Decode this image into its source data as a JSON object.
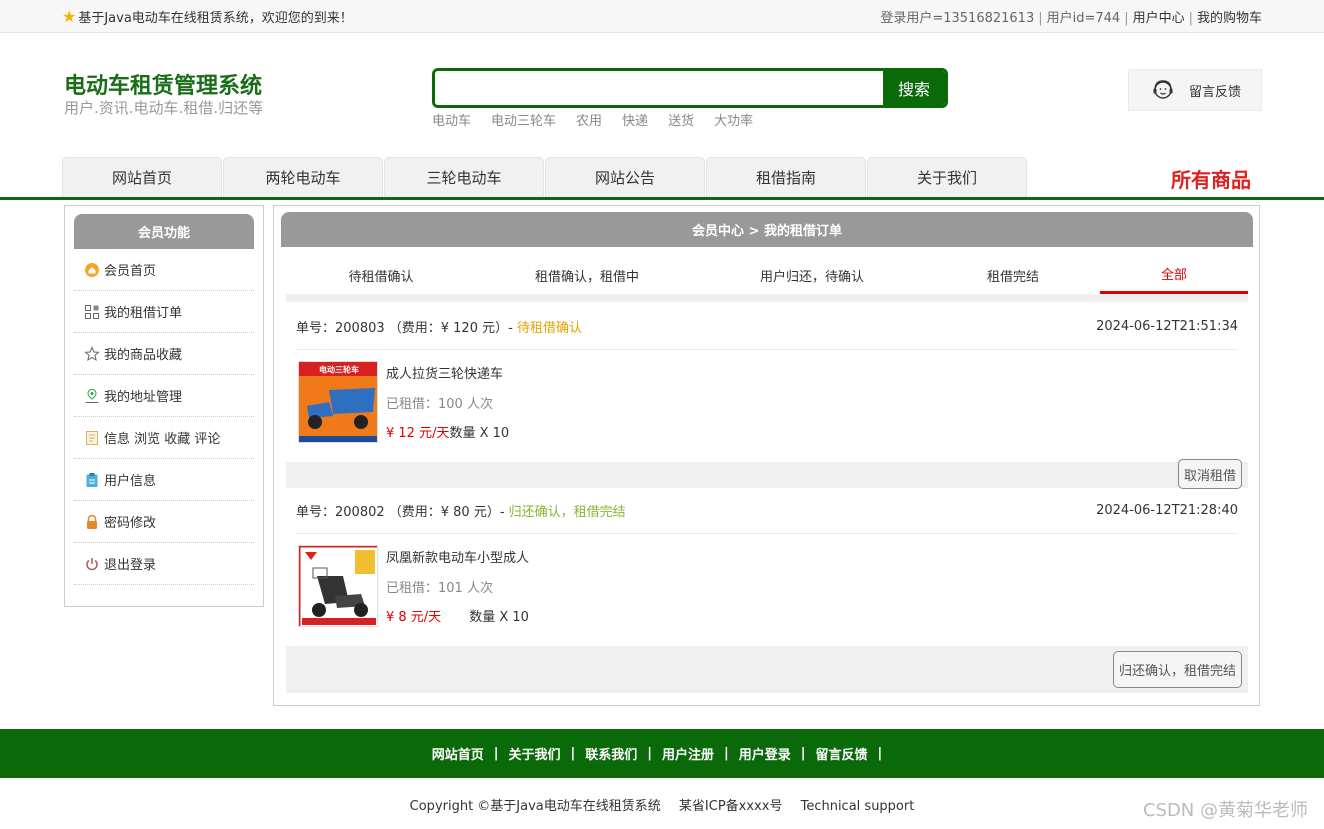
{
  "topbar": {
    "welcome": "基于Java电动车在线租赁系统，欢迎您的到来！",
    "login_user": "登录用户=13516821613",
    "user_id": "用户id=744",
    "user_center": "用户中心",
    "my_cart": "我的购物车"
  },
  "header": {
    "title": "电动车租赁管理系统",
    "subtitle": "用户.资讯.电动车.租借.归还等",
    "search_value": "",
    "search_button": "搜索",
    "hot_words": [
      "电动车",
      "电动三轮车",
      "农用",
      "快递",
      "送货",
      "大功率"
    ],
    "feedback": "留言反馈"
  },
  "nav": {
    "tabs": [
      "网站首页",
      "两轮电动车",
      "三轮电动车",
      "网站公告",
      "租借指南",
      "关于我们"
    ],
    "all_goods": "所有商品"
  },
  "sidebar": {
    "title": "会员功能",
    "items": [
      {
        "label": "会员首页",
        "icon": "home-icon"
      },
      {
        "label": "我的租借订单",
        "icon": "orders-icon"
      },
      {
        "label": "我的商品收藏",
        "icon": "star-icon"
      },
      {
        "label": "我的地址管理",
        "icon": "location-icon"
      },
      {
        "label": "信息 浏览 收藏 评论",
        "icon": "document-icon"
      },
      {
        "label": "用户信息",
        "icon": "clipboard-icon"
      },
      {
        "label": "密码修改",
        "icon": "lock-icon"
      },
      {
        "label": "退出登录",
        "icon": "power-icon"
      }
    ]
  },
  "main": {
    "breadcrumb": "会员中心 > 我的租借订单",
    "status_tabs": [
      "待租借确认",
      "租借确认，租借中",
      "用户归还，待确认",
      "租借完结",
      "全部"
    ],
    "active_tab": "全部",
    "orders": [
      {
        "order_no_label": "单号：200803 （费用：¥ 120 元）-",
        "status": "待租借确认",
        "time": "2024-06-12T21:51:34",
        "product_name": "成人拉货三轮快递车",
        "rented": "已租借：100 人次",
        "price": "¥ 12 元/天",
        "qty": "数量 X 10",
        "action": "取消租借"
      },
      {
        "order_no_label": "单号：200802 （费用：¥ 80 元）-",
        "status": "归还确认，租借完结",
        "time": "2024-06-12T21:28:40",
        "product_name": "凤凰新款电动车小型成人",
        "rented": "已租借：101 人次",
        "price": "¥ 8 元/天",
        "qty": "数量 X 10",
        "action": "归还确认，租借完结"
      }
    ]
  },
  "footer": {
    "links": [
      "网站首页",
      "关于我们",
      "联系我们",
      "用户注册",
      "用户登录",
      "留言反馈"
    ],
    "copyright": "Copyright ©基于Java电动车在线租赁系统",
    "icp": "某省ICP备xxxx号",
    "support": "Technical support",
    "watermark": "CSDN @黄菊华老师"
  },
  "colors": {
    "brand_green": "#0a6a0a",
    "accent_red": "#e00000",
    "status_pending": "#e6a100",
    "status_done": "#8ab332"
  }
}
